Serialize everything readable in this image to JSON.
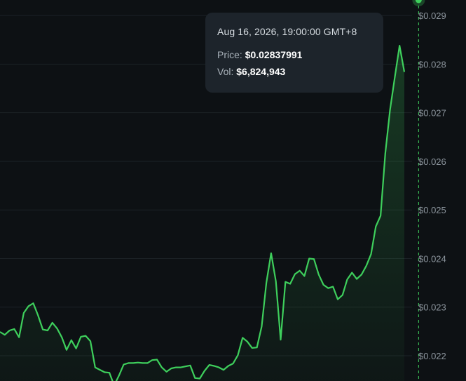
{
  "colors": {
    "background": "#0d1114",
    "line": "#3ecf5c",
    "grid": "#1c2227",
    "tooltip_bg": "#1d242b"
  },
  "tooltip": {
    "time": "Aug 16, 2026, 19:00:00 GMT+8",
    "price_label": "Price:",
    "price_value": "$0.02837991",
    "vol_label": "Vol:",
    "vol_value": "$6,824,943"
  },
  "chart_data": {
    "type": "area",
    "y_ticks": [
      "$0.029",
      "$0.028",
      "$0.027",
      "$0.026",
      "$0.025",
      "$0.024",
      "$0.023",
      "$0.022"
    ],
    "y_tick_values": [
      0.029,
      0.028,
      0.027,
      0.026,
      0.025,
      0.024,
      0.023,
      0.022
    ],
    "ylim": [
      0.02148,
      0.02932
    ],
    "y_axis_position": "right",
    "grid": true,
    "legend": "none",
    "highlight_index": 88,
    "values": [
      0.02249,
      0.02243,
      0.02252,
      0.02255,
      0.02238,
      0.02288,
      0.02302,
      0.02308,
      0.02283,
      0.02254,
      0.02252,
      0.02268,
      0.02256,
      0.02238,
      0.02212,
      0.02232,
      0.02215,
      0.02239,
      0.02241,
      0.0223,
      0.02176,
      0.02171,
      0.02166,
      0.02165,
      0.02139,
      0.02159,
      0.02182,
      0.02185,
      0.02185,
      0.02186,
      0.02185,
      0.02185,
      0.02191,
      0.02192,
      0.02176,
      0.02167,
      0.02174,
      0.02176,
      0.02176,
      0.02178,
      0.0218,
      0.02154,
      0.02153,
      0.02169,
      0.02181,
      0.02179,
      0.02176,
      0.02171,
      0.02179,
      0.02184,
      0.02201,
      0.02237,
      0.02229,
      0.02216,
      0.02217,
      0.0226,
      0.0235,
      0.02411,
      0.02353,
      0.02233,
      0.02352,
      0.02348,
      0.02368,
      0.02375,
      0.02364,
      0.024,
      0.02399,
      0.02367,
      0.02346,
      0.02339,
      0.02342,
      0.02316,
      0.02325,
      0.02357,
      0.02371,
      0.02358,
      0.02367,
      0.02385,
      0.02409,
      0.02466,
      0.02488,
      0.02616,
      0.02706,
      0.02773,
      0.02838,
      0.02784
    ]
  }
}
